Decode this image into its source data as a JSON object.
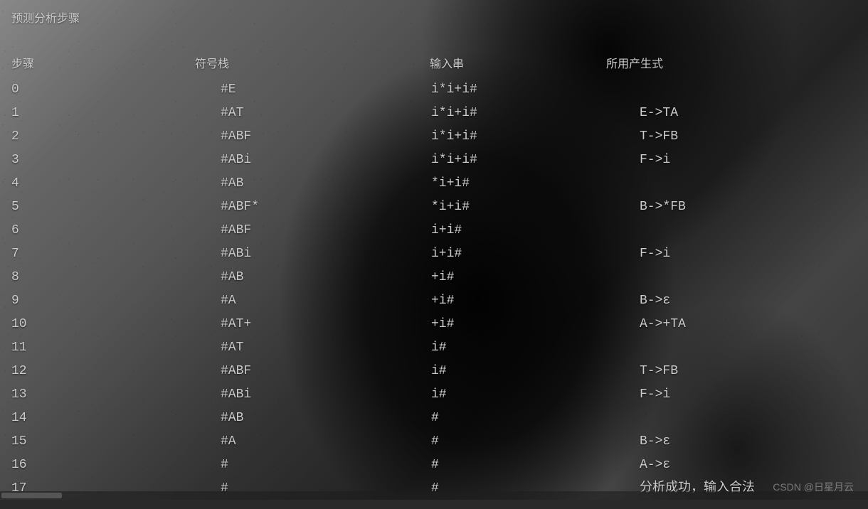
{
  "title": "预测分析步骤",
  "headers": {
    "step": "步骤",
    "stack": "符号栈",
    "input": "输入串",
    "production": "所用产生式"
  },
  "rows": [
    {
      "step": "0",
      "stack": "#E",
      "input": "i*i+i#",
      "production": ""
    },
    {
      "step": "1",
      "stack": "#AT",
      "input": "i*i+i#",
      "production": "E->TA"
    },
    {
      "step": "2",
      "stack": "#ABF",
      "input": "i*i+i#",
      "production": "T->FB"
    },
    {
      "step": "3",
      "stack": "#ABi",
      "input": "i*i+i#",
      "production": "F->i"
    },
    {
      "step": "4",
      "stack": "#AB",
      "input": "*i+i#",
      "production": ""
    },
    {
      "step": "5",
      "stack": "#ABF*",
      "input": "*i+i#",
      "production": "B->*FB"
    },
    {
      "step": "6",
      "stack": "#ABF",
      "input": "i+i#",
      "production": ""
    },
    {
      "step": "7",
      "stack": "#ABi",
      "input": "i+i#",
      "production": "F->i"
    },
    {
      "step": "8",
      "stack": "#AB",
      "input": "+i#",
      "production": ""
    },
    {
      "step": "9",
      "stack": "#A",
      "input": "+i#",
      "production": "B->ε"
    },
    {
      "step": "10",
      "stack": "#AT+",
      "input": "+i#",
      "production": "A->+TA"
    },
    {
      "step": "11",
      "stack": "#AT",
      "input": "i#",
      "production": ""
    },
    {
      "step": "12",
      "stack": "#ABF",
      "input": "i#",
      "production": "T->FB"
    },
    {
      "step": "13",
      "stack": "#ABi",
      "input": "i#",
      "production": "F->i"
    },
    {
      "step": "14",
      "stack": "#AB",
      "input": "#",
      "production": ""
    },
    {
      "step": "15",
      "stack": "#A",
      "input": "#",
      "production": "B->ε"
    },
    {
      "step": "16",
      "stack": "#",
      "input": "#",
      "production": "A->ε"
    },
    {
      "step": "17",
      "stack": "#",
      "input": "#",
      "production": "分析成功，输入合法"
    }
  ],
  "watermark": "CSDN @日星月云"
}
